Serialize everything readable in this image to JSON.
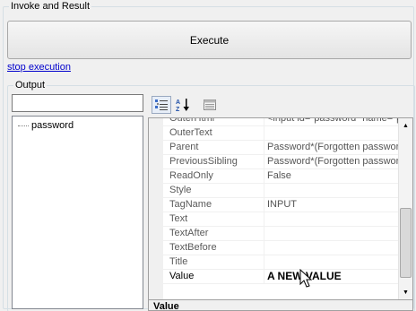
{
  "invoke_group": {
    "title": "Invoke and Result"
  },
  "execute_label": "Execute",
  "stop_link": "stop execution",
  "output_group": {
    "title": "Output",
    "input_value": ""
  },
  "tree": {
    "items": [
      "password"
    ]
  },
  "toolbar": {
    "categorized_icon": "categorized-icon",
    "alphabetical_icon": "alphabetical-sort-icon",
    "property_pages_icon": "property-pages-icon"
  },
  "properties": [
    {
      "name": "OuterHtml",
      "value": "<input id=\"password\" name=\"pa"
    },
    {
      "name": "OuterText",
      "value": ""
    },
    {
      "name": "Parent",
      "value": "Password*(Forgotten password'"
    },
    {
      "name": "PreviousSibling",
      "value": "Password*(Forgotten password'"
    },
    {
      "name": "ReadOnly",
      "value": "False"
    },
    {
      "name": "Style",
      "value": ""
    },
    {
      "name": "TagName",
      "value": "INPUT"
    },
    {
      "name": "Text",
      "value": ""
    },
    {
      "name": "TextAfter",
      "value": ""
    },
    {
      "name": "TextBefore",
      "value": ""
    },
    {
      "name": "Title",
      "value": ""
    },
    {
      "name": "Value",
      "value": "A NEW VALUE"
    }
  ],
  "description": {
    "title": "Value"
  }
}
